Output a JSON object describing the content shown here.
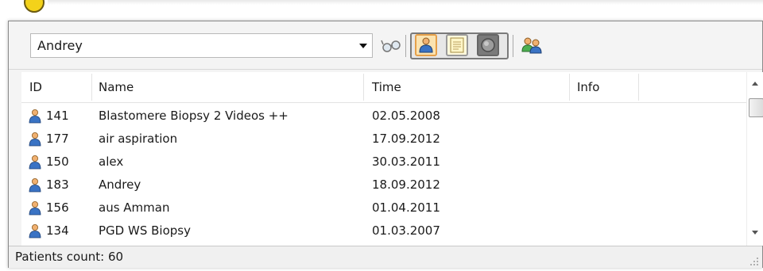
{
  "toolbar": {
    "user_combo": {
      "value": "Andrey"
    },
    "icons": [
      "glasses-icon",
      "patient-view-icon",
      "notes-view-icon",
      "disc-view-icon",
      "patients-group-icon"
    ]
  },
  "table": {
    "columns": [
      "ID",
      "Name",
      "Time",
      "Info"
    ],
    "rows": [
      {
        "id": "141",
        "name": "Blastomere Biopsy 2 Videos ++",
        "time": "02.05.2008",
        "info": ""
      },
      {
        "id": "177",
        "name": "air aspiration",
        "time": "17.09.2012",
        "info": ""
      },
      {
        "id": "150",
        "name": "alex",
        "time": "30.03.2011",
        "info": ""
      },
      {
        "id": "183",
        "name": "Andrey",
        "time": "18.09.2012",
        "info": ""
      },
      {
        "id": "156",
        "name": "aus Amman",
        "time": "01.04.2011",
        "info": ""
      },
      {
        "id": "134",
        "name": "PGD WS Biopsy",
        "time": "01.03.2007",
        "info": ""
      }
    ]
  },
  "status": {
    "patients_count": "Patients count: 60"
  },
  "colors": {
    "selected_tool_border": "#e5a04a",
    "patient_icon": "#3a73c4"
  }
}
